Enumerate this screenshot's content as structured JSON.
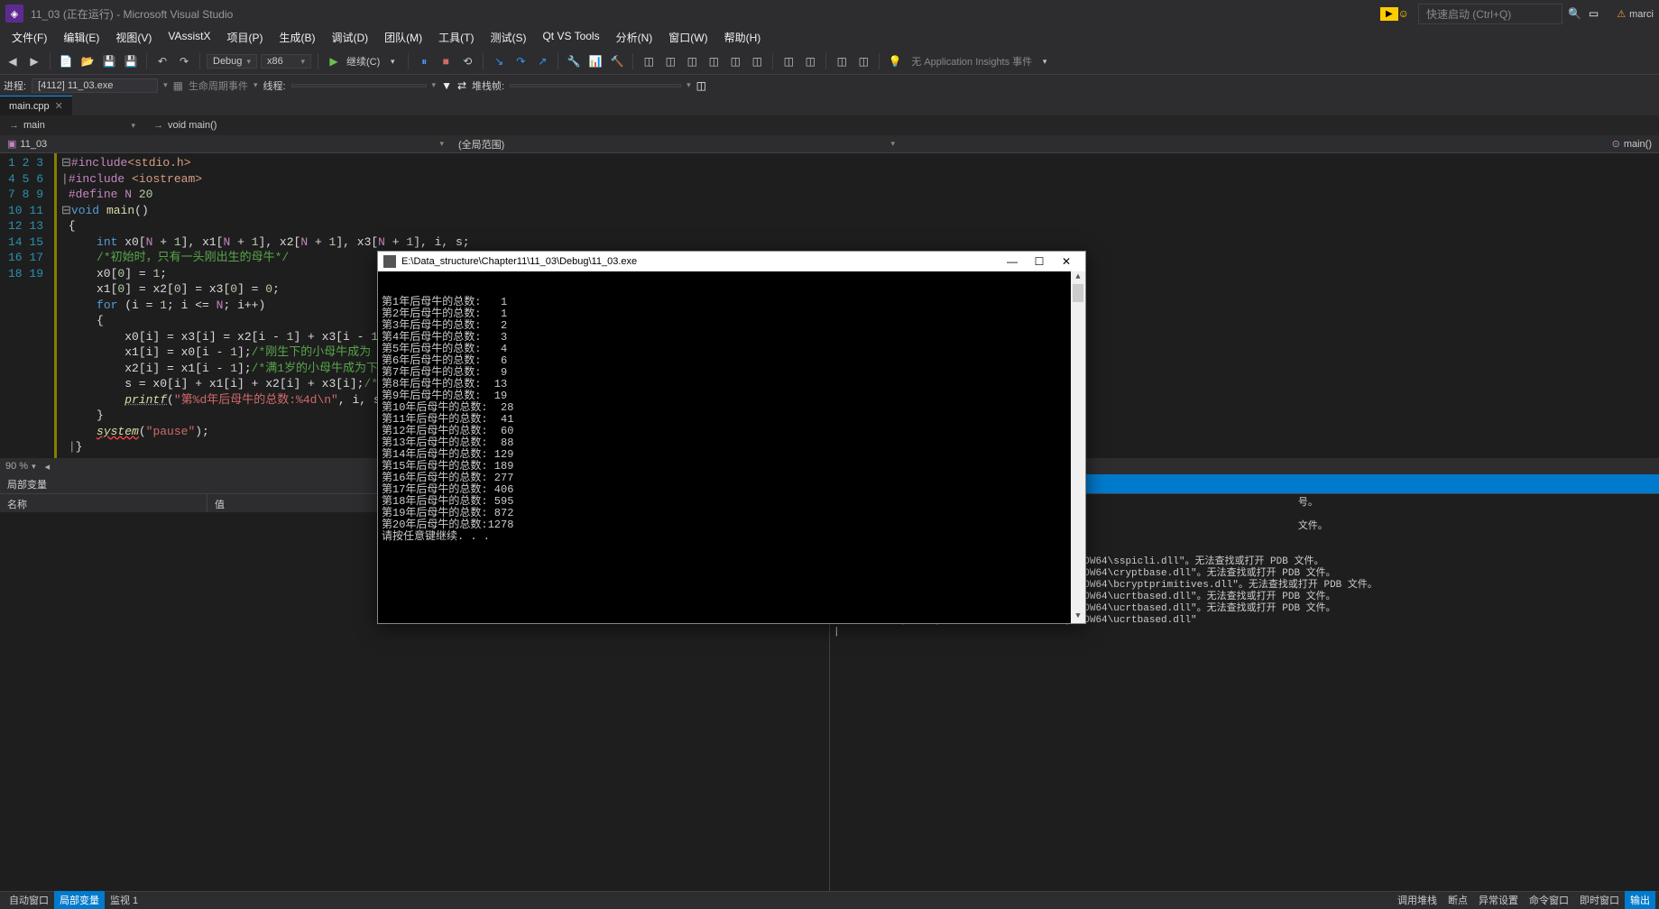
{
  "title_bar": {
    "title": "11_03 (正在运行) - Microsoft Visual Studio",
    "quick_launch": "快速启动 (Ctrl+Q)",
    "user": "marci"
  },
  "menu": [
    "文件(F)",
    "编辑(E)",
    "视图(V)",
    "VAssistX",
    "项目(P)",
    "生成(B)",
    "调试(D)",
    "团队(M)",
    "工具(T)",
    "测试(S)",
    "Qt VS Tools",
    "分析(N)",
    "窗口(W)",
    "帮助(H)"
  ],
  "toolbar": {
    "config": "Debug",
    "platform": "x86",
    "continue": "继续(C)",
    "insights": "无 Application Insights 事件"
  },
  "process_bar": {
    "label": "进程:",
    "process": "[4112] 11_03.exe",
    "life_events": "生命周期事件",
    "thread_label": "线程:",
    "thread": "",
    "stack_label": "堆栈帧:",
    "stack": ""
  },
  "tab": {
    "name": "main.cpp"
  },
  "nav": {
    "scope": "main",
    "func": "void main()"
  },
  "nav2": {
    "project": "11_03",
    "scope2": "(全局范围)",
    "func2": "main()"
  },
  "code_lines": [
    {
      "n": 1,
      "html": "<span class='d'>⊟</span><span class='p'>#include</span><span class='s'>&lt;stdio.h&gt;</span>"
    },
    {
      "n": 2,
      "html": "<span class='d'>|</span><span class='p'>#include</span> <span class='s'>&lt;iostream&gt;</span>"
    },
    {
      "n": 3,
      "html": " <span class='p'>#define</span> <span class='p'>N</span> <span class='n'>20</span>"
    },
    {
      "n": 4,
      "html": "<span class='d'>⊟</span><span class='k'>void</span> <span class='fn'>main</span>()"
    },
    {
      "n": 5,
      "html": " {"
    },
    {
      "n": 6,
      "html": "     <span class='k'>int</span> x0[<span class='p'>N</span> + <span class='n'>1</span>], x1[<span class='p'>N</span> + <span class='n'>1</span>], x2[<span class='p'>N</span> + <span class='n'>1</span>], x3[<span class='p'>N</span> + <span class='n'>1</span>], i, s;"
    },
    {
      "n": 7,
      "html": "     <span class='c'>/*初始时，只有一头刚出生的母牛*/</span>"
    },
    {
      "n": 8,
      "html": "     x0[<span class='n'>0</span>] = <span class='n'>1</span>;"
    },
    {
      "n": 9,
      "html": "     x1[<span class='n'>0</span>] = x2[<span class='n'>0</span>] = x3[<span class='n'>0</span>] = <span class='n'>0</span>;"
    },
    {
      "n": 10,
      "html": "     <span class='k'>for</span> (i = <span class='n'>1</span>; i &lt;= <span class='p'>N</span>; i++)"
    },
    {
      "n": 11,
      "html": "     {"
    },
    {
      "n": 12,
      "html": "         x0[i] = x3[i] = x2[i - <span class='n'>1</span>] + x3[i - <span class='n'>1</span>];<span class='c'>/</span>"
    },
    {
      "n": 13,
      "html": "         x1[i] = x0[i - <span class='n'>1</span>];<span class='c'>/*刚生下的小母牛成为</span>"
    },
    {
      "n": 14,
      "html": "         x2[i] = x1[i - <span class='n'>1</span>];<span class='c'>/*满1岁的小母牛成为下</span>"
    },
    {
      "n": 15,
      "html": "         s = x0[i] + x1[i] + x2[i] + x3[i];<span class='c'>/*第i</span>"
    },
    {
      "n": 16,
      "html": "         <span class='f'>printf</span>(<span class='strred'>\"第%d年后母牛的总数:%4d\\n\"</span>, i, s"
    },
    {
      "n": 17,
      "html": "     }"
    },
    {
      "n": 18,
      "html": "     <span class='f err'>system</span>(<span class='strred'>\"pause\"</span>);"
    },
    {
      "n": 19,
      "html": " <span class='d'>|</span>}"
    }
  ],
  "editor_zoom": "90 %",
  "locals_panel": {
    "title": "局部变量",
    "cols": {
      "name": "名称",
      "value": "值"
    }
  },
  "output_panel": {
    "title_cut": "号。",
    "lines": [
      "\"11_03.exe\"(Win32): 已加载 \"C:\\Windows\\SysWOW64\\sspicli.dll\"。无法查找或打开 PDB 文件。",
      "\"11_03.exe\"(Win32): 已加载 \"C:\\Windows\\SysWOW64\\cryptbase.dll\"。无法查找或打开 PDB 文件。",
      "\"11_03.exe\"(Win32): 已加载 \"C:\\Windows\\SysWOW64\\bcryptprimitives.dll\"。无法查找或打开 PDB 文件。",
      "\"11_03.exe\"(Win32): 已加载 \"C:\\Windows\\SysWOW64\\ucrtbased.dll\"。无法查找或打开 PDB 文件。",
      "\"11_03.exe\"(Win32): 已加载 \"C:\\Windows\\SysWOW64\\ucrtbased.dll\"。无法查找或打开 PDB 文件。",
      "\"11_03.exe\"(Win32): 已卸载 \"C:\\Windows\\SysWOW64\\ucrtbased.dll\""
    ],
    "extra_cut1": "",
    "extra_cut2": "文件。"
  },
  "status": {
    "left": [
      "自动窗口",
      "局部变量",
      "监视 1"
    ],
    "right": [
      "调用堆栈",
      "断点",
      "异常设置",
      "命令窗口",
      "即时窗口",
      "输出"
    ]
  },
  "console": {
    "title": "E:\\Data_structure\\Chapter11\\11_03\\Debug\\11_03.exe",
    "rows": [
      "第1年后母牛的总数:   1",
      "第2年后母牛的总数:   1",
      "第3年后母牛的总数:   2",
      "第4年后母牛的总数:   3",
      "第5年后母牛的总数:   4",
      "第6年后母牛的总数:   6",
      "第7年后母牛的总数:   9",
      "第8年后母牛的总数:  13",
      "第9年后母牛的总数:  19",
      "第10年后母牛的总数:  28",
      "第11年后母牛的总数:  41",
      "第12年后母牛的总数:  60",
      "第13年后母牛的总数:  88",
      "第14年后母牛的总数: 129",
      "第15年后母牛的总数: 189",
      "第16年后母牛的总数: 277",
      "第17年后母牛的总数: 406",
      "第18年后母牛的总数: 595",
      "第19年后母牛的总数: 872",
      "第20年后母牛的总数:1278",
      "请按任意键继续. . ."
    ]
  }
}
